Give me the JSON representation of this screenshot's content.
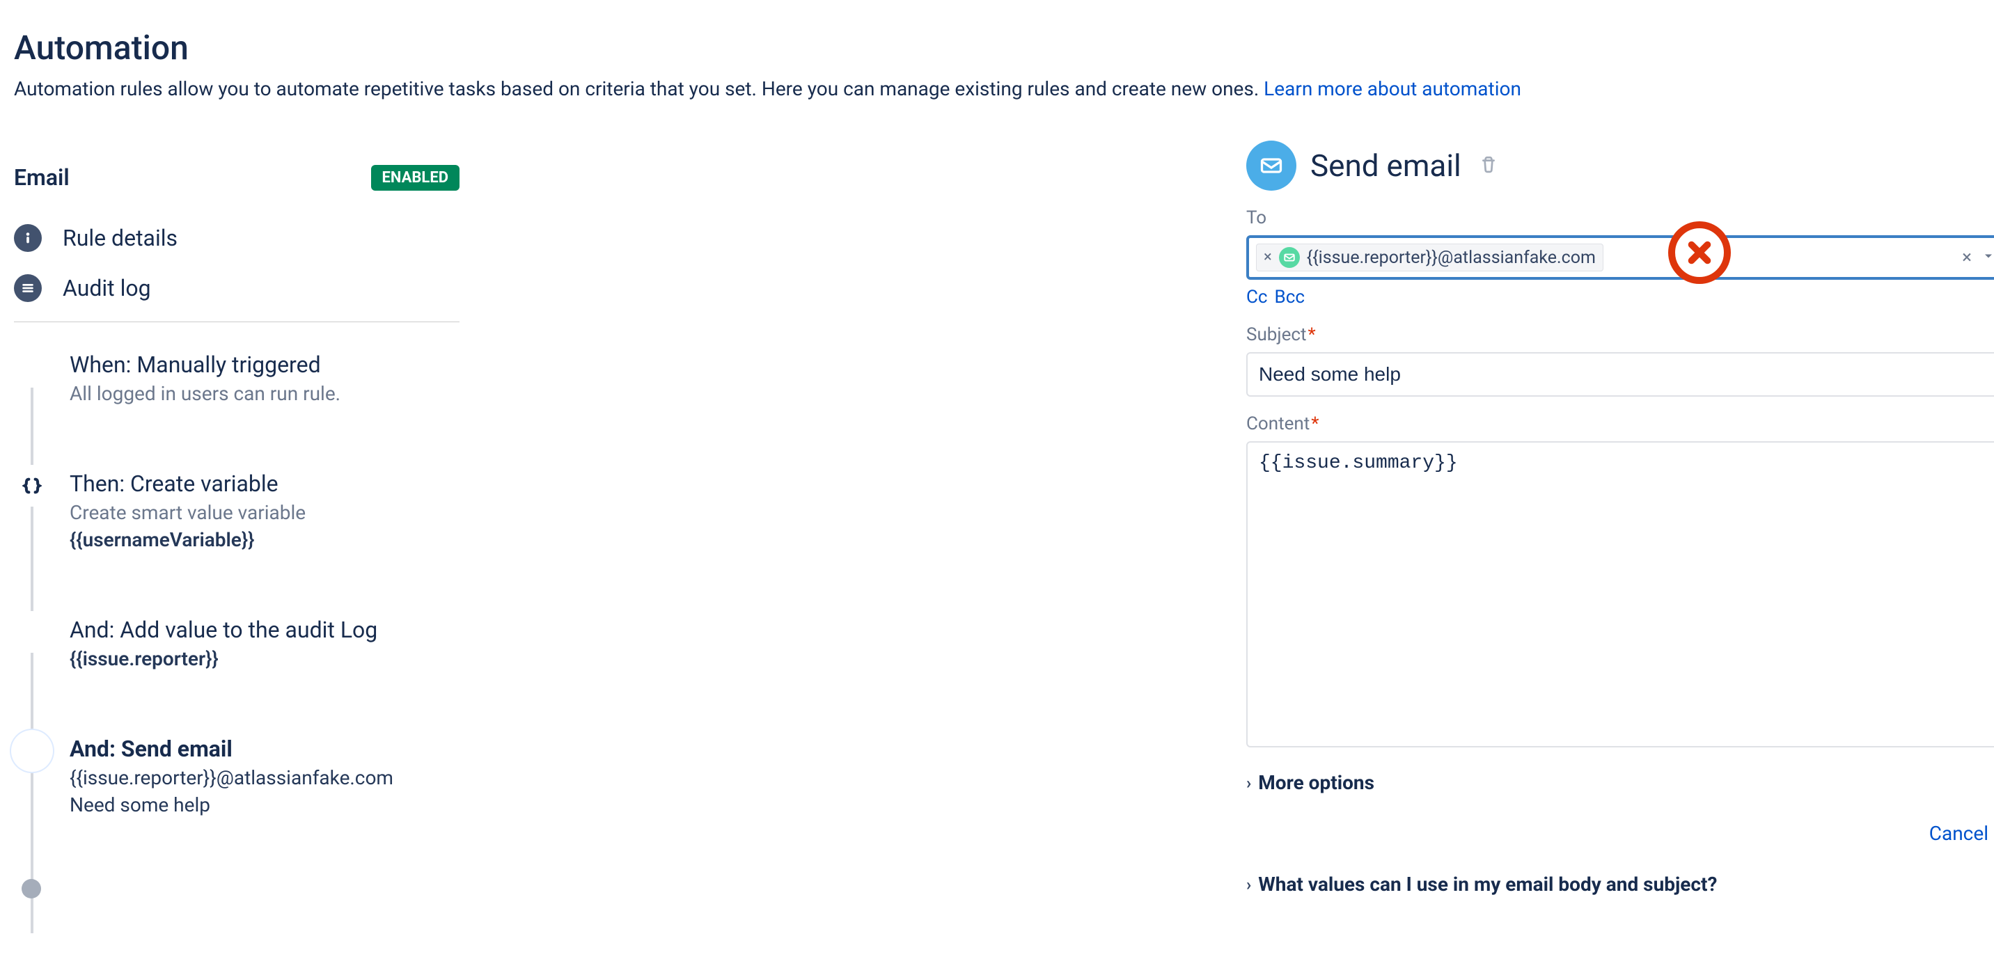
{
  "header": {
    "title": "Automation",
    "subtitle_a": "Automation rules allow you to automate repetitive tasks based on criteria that you set. Here you can manage existing rules and create new ones. ",
    "subtitle_link": "Learn more about automation"
  },
  "rule": {
    "name": "Email",
    "enabled_badge": "ENABLED"
  },
  "nav": {
    "rule_details": "Rule details",
    "audit_log": "Audit log"
  },
  "steps": {
    "s0": {
      "title": "When: Manually triggered",
      "desc": "All logged in users can run rule."
    },
    "s1": {
      "title": "Then: Create variable",
      "desc": "Create smart value variable",
      "meta": "{{usernameVariable}}"
    },
    "s2": {
      "title": "And: Add value to the audit Log",
      "meta": "{{issue.reporter}}"
    },
    "s3": {
      "title": "And: Send email",
      "line1": "{{issue.reporter}}@atlassianfake.com",
      "line2": "Need some help"
    }
  },
  "panel": {
    "title": "Send email",
    "to_label": "To",
    "to_chip": "{{issue.reporter}}@atlassianfake.com",
    "cc": "Cc",
    "bcc": "Bcc",
    "subject_label": "Subject",
    "subject_value": "Need some help",
    "content_label": "Content",
    "content_value": "{{issue.summary}}",
    "more_options": "More options",
    "smart_values_expander": "What values can I use in my email body and subject?",
    "cancel": "Cancel"
  }
}
